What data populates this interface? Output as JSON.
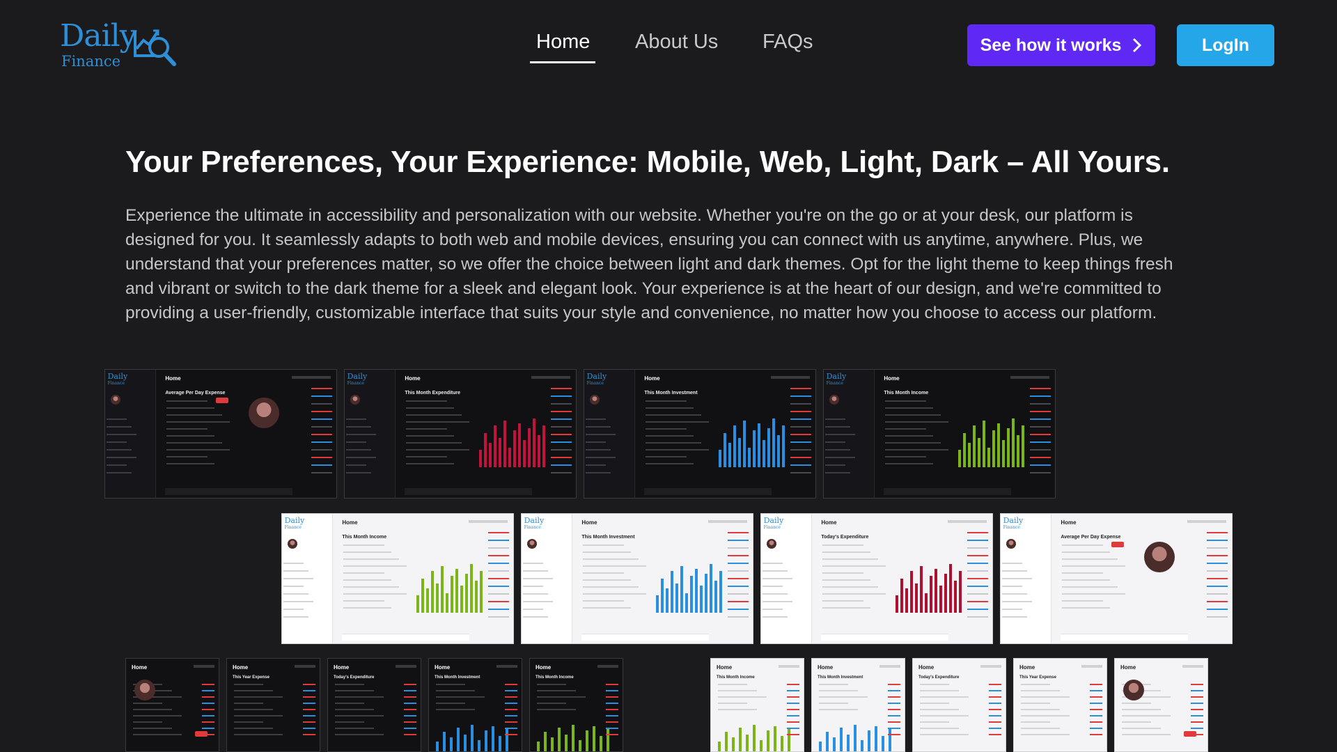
{
  "brand": {
    "name": "Daily",
    "sub": "Finance"
  },
  "nav": {
    "links": [
      {
        "label": "Home",
        "active": true
      },
      {
        "label": "About Us",
        "active": false
      },
      {
        "label": "FAQs",
        "active": false
      }
    ]
  },
  "actions": {
    "how_label": "See how it works",
    "login_label": "LogIn"
  },
  "main": {
    "headline": "Your Preferences, Your Experience: Mobile, Web, Light, Dark – All Yours.",
    "paragraph": "Experience the ultimate in accessibility and personalization with our website. Whether you're on the go or at your desk, our platform is designed for you. It seamlessly adapts to both web and mobile devices, ensuring you can connect with us anytime, anywhere. Plus, we understand that your preferences matter, so we offer the choice between light and dark themes. Opt for the light theme to keep things fresh and vibrant or switch to the dark theme for a sleek and elegant look. Your experience is at the heart of our design, and we're committed to providing a user-friendly, customizable interface that suits your style and convenience, no matter how you choose to access our platform."
  },
  "screenshots": {
    "row1": [
      {
        "theme": "dark",
        "title": "Home",
        "sub": "Average Per Day Expense",
        "kind": "home"
      },
      {
        "theme": "dark",
        "title": "Home",
        "sub": "This Month Expenditure",
        "kind": "bars",
        "color": "#c0143c"
      },
      {
        "theme": "dark",
        "title": "Home",
        "sub": "This Month Investment",
        "kind": "bars",
        "color": "#2a8fe0"
      },
      {
        "theme": "dark",
        "title": "Home",
        "sub": "This Month Income",
        "kind": "bars",
        "color": "#7cb518"
      }
    ],
    "row2": [
      {
        "theme": "light",
        "title": "Home",
        "sub": "This Month Income",
        "kind": "bars",
        "color": "#7cb518"
      },
      {
        "theme": "light",
        "title": "Home",
        "sub": "This Month Investment",
        "kind": "bars",
        "color": "#2a8fe0"
      },
      {
        "theme": "light",
        "title": "Home",
        "sub": "Today's Expenditure",
        "kind": "bars",
        "color": "#b01030"
      },
      {
        "theme": "light",
        "title": "Home",
        "sub": "Average Per Day Expense",
        "kind": "home"
      }
    ],
    "row3": [
      {
        "theme": "dark",
        "title": "Home",
        "sub": "",
        "kind": "mobile-home"
      },
      {
        "theme": "dark",
        "title": "Home",
        "sub": "This Year Expense",
        "kind": "mobile-list"
      },
      {
        "theme": "dark",
        "title": "Home",
        "sub": "Today's Expenditure",
        "kind": "mobile-list"
      },
      {
        "theme": "dark",
        "title": "Home",
        "sub": "This Month Investment",
        "kind": "mobile-bars",
        "color": "#2a8fe0"
      },
      {
        "theme": "dark",
        "title": "Home",
        "sub": "This Month Income",
        "kind": "mobile-bars",
        "color": "#7cb518"
      },
      {
        "theme": "light",
        "title": "Home",
        "sub": "This Month Income",
        "kind": "mobile-bars",
        "color": "#7cb518"
      },
      {
        "theme": "light",
        "title": "Home",
        "sub": "This Month Investment",
        "kind": "mobile-bars",
        "color": "#2a8fe0"
      },
      {
        "theme": "light",
        "title": "Home",
        "sub": "Today's Expenditure",
        "kind": "mobile-list"
      },
      {
        "theme": "light",
        "title": "Home",
        "sub": "This Year Expense",
        "kind": "mobile-list"
      },
      {
        "theme": "light",
        "title": "Home",
        "sub": "",
        "kind": "mobile-home"
      }
    ]
  }
}
